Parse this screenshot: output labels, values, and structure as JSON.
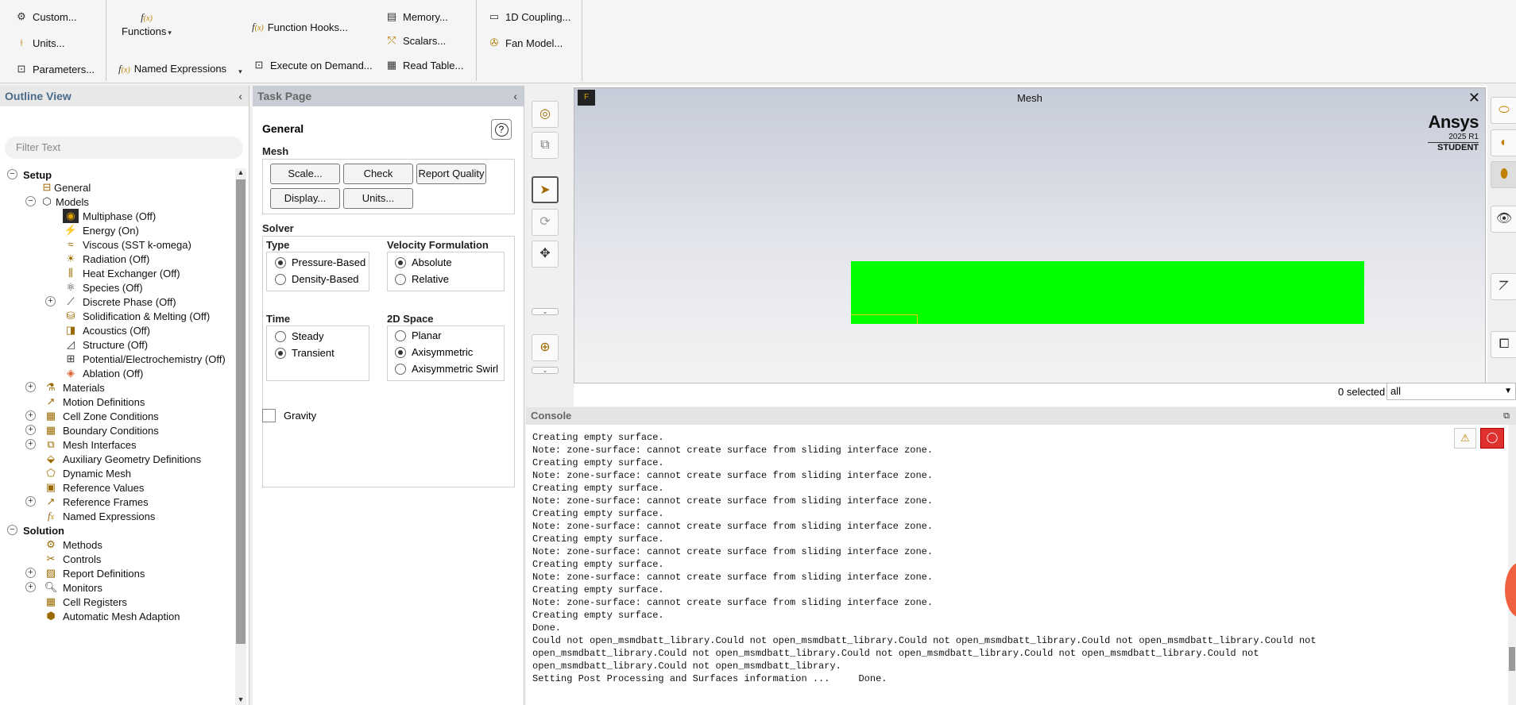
{
  "ribbon": {
    "custom": "Custom...",
    "units": "Units...",
    "parameters": "Parameters...",
    "functions": "Functions",
    "named_expressions": "Named Expressions",
    "function_hooks": "Function Hooks...",
    "execute_on_demand": "Execute on Demand...",
    "memory": "Memory...",
    "scalars": "Scalars...",
    "read_table": "Read Table...",
    "coupling_1d": "1D Coupling...",
    "fan_model": "Fan Model..."
  },
  "outline": {
    "title": "Outline View",
    "filter_placeholder": "Filter Text",
    "items": [
      {
        "label": "Setup",
        "icon": "none"
      },
      {
        "label": "General",
        "icon": "general-icon"
      },
      {
        "label": "Models",
        "icon": "models-icon"
      },
      {
        "label": "Multiphase (Off)",
        "icon": "multiphase-icon"
      },
      {
        "label": "Energy (On)",
        "icon": "energy-icon"
      },
      {
        "label": "Viscous (SST k-omega)",
        "icon": "viscous-icon"
      },
      {
        "label": "Radiation (Off)",
        "icon": "radiation-icon"
      },
      {
        "label": "Heat Exchanger (Off)",
        "icon": "heat-exchanger-icon"
      },
      {
        "label": "Species (Off)",
        "icon": "species-icon"
      },
      {
        "label": "Discrete Phase (Off)",
        "icon": "discrete-phase-icon"
      },
      {
        "label": "Solidification & Melting (Off)",
        "icon": "solidification-icon"
      },
      {
        "label": "Acoustics (Off)",
        "icon": "acoustics-icon"
      },
      {
        "label": "Structure (Off)",
        "icon": "structure-icon"
      },
      {
        "label": "Potential/Electrochemistry (Off)",
        "icon": "potential-icon"
      },
      {
        "label": "Ablation (Off)",
        "icon": "ablation-icon"
      },
      {
        "label": "Materials",
        "icon": "materials-icon"
      },
      {
        "label": "Motion Definitions",
        "icon": "motion-icon"
      },
      {
        "label": "Cell Zone Conditions",
        "icon": "cell-zone-icon"
      },
      {
        "label": "Boundary Conditions",
        "icon": "boundary-icon"
      },
      {
        "label": "Mesh Interfaces",
        "icon": "mesh-interfaces-icon"
      },
      {
        "label": "Auxiliary Geometry Definitions",
        "icon": "aux-geometry-icon"
      },
      {
        "label": "Dynamic Mesh",
        "icon": "dynamic-mesh-icon"
      },
      {
        "label": "Reference Values",
        "icon": "reference-values-icon"
      },
      {
        "label": "Reference Frames",
        "icon": "reference-frames-icon"
      },
      {
        "label": "Named Expressions",
        "icon": "fx-icon"
      },
      {
        "label": "Solution",
        "icon": "none"
      },
      {
        "label": "Methods",
        "icon": "methods-icon"
      },
      {
        "label": "Controls",
        "icon": "controls-icon"
      },
      {
        "label": "Report Definitions",
        "icon": "report-icon"
      },
      {
        "label": "Monitors",
        "icon": "monitors-icon"
      },
      {
        "label": "Cell Registers",
        "icon": "cell-registers-icon"
      },
      {
        "label": "Automatic Mesh Adaption",
        "icon": "mesh-adaption-icon"
      }
    ]
  },
  "task": {
    "title": "Task Page",
    "page": "General",
    "help": "?",
    "mesh_label": "Mesh",
    "scale": "Scale...",
    "check": "Check",
    "report_quality": "Report Quality",
    "display": "Display...",
    "units": "Units...",
    "solver_label": "Solver",
    "type_label": "Type",
    "pressure_based": "Pressure-Based",
    "density_based": "Density-Based",
    "velocity_label": "Velocity Formulation",
    "absolute": "Absolute",
    "relative": "Relative",
    "time_label": "Time",
    "steady": "Steady",
    "transient": "Transient",
    "space_label": "2D Space",
    "planar": "Planar",
    "axisymmetric": "Axisymmetric",
    "axisymmetric_swirl": "Axisymmetric Swirl",
    "gravity": "Gravity"
  },
  "graphics": {
    "title": "Mesh",
    "close": "✕",
    "brand": "Ansys",
    "version": "2025 R1",
    "edition": "STUDENT",
    "selected": "0 selected",
    "filter": "all",
    "mesh_color": "#00ff00"
  },
  "console": {
    "title": "Console",
    "lines": [
      "Creating empty surface.",
      "Note: zone-surface: cannot create surface from sliding interface zone.",
      "Creating empty surface.",
      "Note: zone-surface: cannot create surface from sliding interface zone.",
      "Creating empty surface.",
      "Note: zone-surface: cannot create surface from sliding interface zone.",
      "Creating empty surface.",
      "Note: zone-surface: cannot create surface from sliding interface zone.",
      "Creating empty surface.",
      "Note: zone-surface: cannot create surface from sliding interface zone.",
      "Creating empty surface.",
      "Note: zone-surface: cannot create surface from sliding interface zone.",
      "Creating empty surface.",
      "Note: zone-surface: cannot create surface from sliding interface zone.",
      "Creating empty surface.",
      "Done.",
      "Could not open_msmdbatt_library.Could not open_msmdbatt_library.Could not open_msmdbatt_library.Could not open_msmdbatt_library.Could not",
      "open_msmdbatt_library.Could not open_msmdbatt_library.Could not open_msmdbatt_library.Could not open_msmdbatt_library.Could not",
      "open_msmdbatt_library.Could not open_msmdbatt_library.",
      "Setting Post Processing and Surfaces information ...     Done."
    ]
  }
}
